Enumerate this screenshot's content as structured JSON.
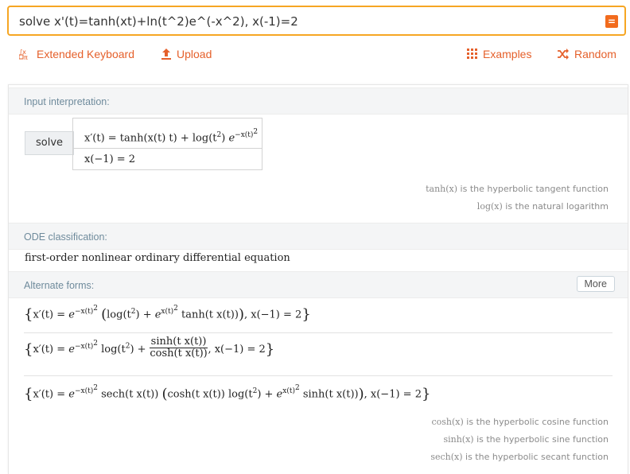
{
  "search": {
    "query": "solve x'(t)=tanh(xt)+ln(t^2)e^(-x^2), x(-1)=2"
  },
  "toolbar": {
    "extended_keyboard": "Extended Keyboard",
    "upload": "Upload",
    "examples": "Examples",
    "random": "Random"
  },
  "accent_color": "#e5602b",
  "pods": {
    "input": {
      "title": "Input interpretation:",
      "solve_label": "solve",
      "note1_fn": "tanh(x)",
      "note1_text": " is the hyperbolic tangent function",
      "note2_fn": "log(x)",
      "note2_text": " is the natural logarithm"
    },
    "ode": {
      "title": "ODE classification:",
      "value": "first-order nonlinear ordinary differential equation"
    },
    "alternate": {
      "title": "Alternate forms:",
      "more_label": "More",
      "note1_fn": "cosh(x)",
      "note1_text": " is the hyperbolic cosine function",
      "note2_fn": "sinh(x)",
      "note2_text": " is the hyperbolic sine function",
      "note3_fn": "sech(x)",
      "note3_text": " is the hyperbolic secant function"
    }
  }
}
